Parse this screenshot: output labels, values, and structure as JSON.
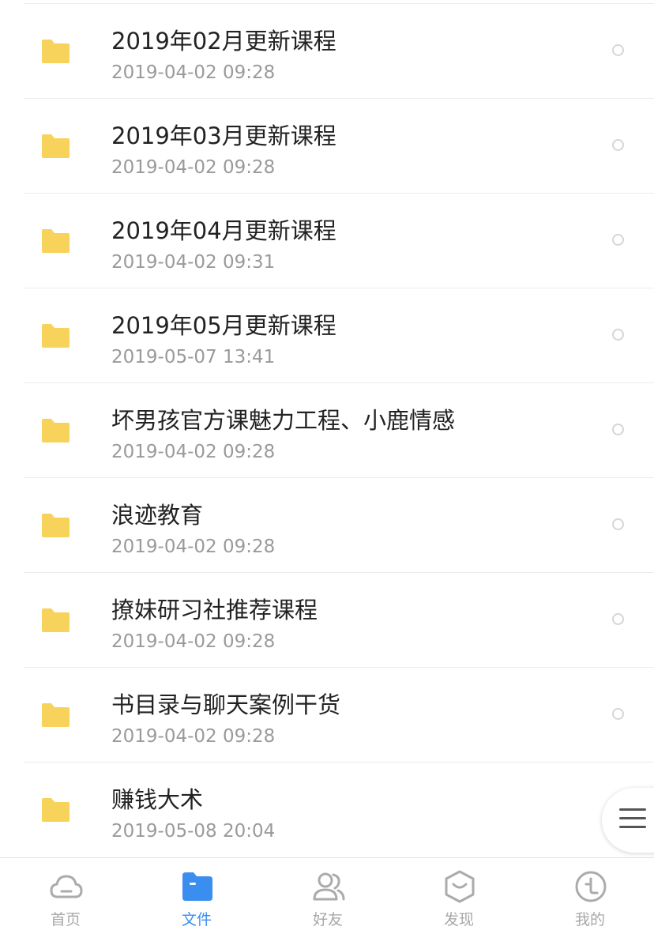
{
  "files": [
    {
      "name": "2019年02月更新课程",
      "time": "2019-04-02 09:28"
    },
    {
      "name": "2019年03月更新课程",
      "time": "2019-04-02 09:28"
    },
    {
      "name": "2019年04月更新课程",
      "time": "2019-04-02 09:31"
    },
    {
      "name": "2019年05月更新课程",
      "time": "2019-05-07 13:41"
    },
    {
      "name": "坏男孩官方课魅力工程、小鹿情感",
      "time": "2019-04-02 09:28"
    },
    {
      "name": "浪迹教育",
      "time": "2019-04-02 09:28"
    },
    {
      "name": "撩妹研习社推荐课程",
      "time": "2019-04-02 09:28"
    },
    {
      "name": "书目录与聊天案例干货",
      "time": "2019-04-02 09:28"
    },
    {
      "name": "赚钱大术",
      "time": "2019-05-08 20:04"
    }
  ],
  "tabs": [
    {
      "label": "首页",
      "icon": "cloud-icon",
      "active": false
    },
    {
      "label": "文件",
      "icon": "folder-icon",
      "active": true
    },
    {
      "label": "好友",
      "icon": "friends-icon",
      "active": false
    },
    {
      "label": "发现",
      "icon": "discover-icon",
      "active": false
    },
    {
      "label": "我的",
      "icon": "profile-icon",
      "active": false
    }
  ],
  "colors": {
    "folder": "#F7D35B",
    "active_tab": "#3A8EF0",
    "inactive_tab": "#A8A8A8",
    "title_text": "#222222",
    "time_text": "#9A9A9A"
  }
}
